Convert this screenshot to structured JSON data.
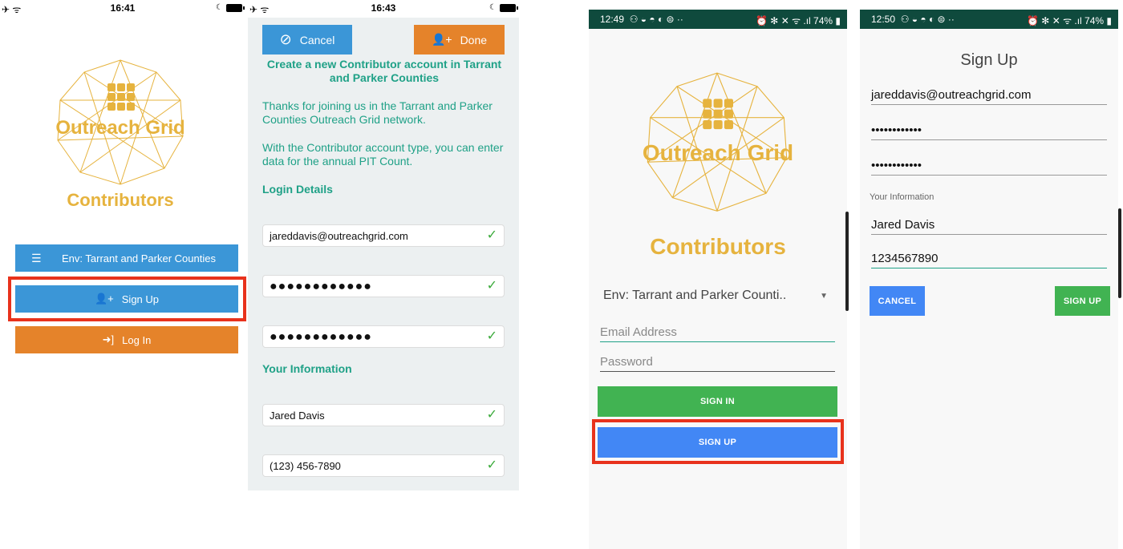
{
  "screen1": {
    "status": {
      "time": "16:41",
      "left": "✈ ᯤ"
    },
    "logo": {
      "title": "Outreach Grid",
      "subtitle": "Contributors"
    },
    "env_button": "Env: Tarrant and Parker Counties",
    "signup_button": "Sign Up",
    "login_button": "Log In"
  },
  "screen2": {
    "status": {
      "time": "16:43",
      "left": "✈ ᯤ"
    },
    "cancel_button": "Cancel",
    "done_button": "Done",
    "heading": "Create a new Contributor account in Tarrant and Parker Counties",
    "intro1": "Thanks for joining us in the Tarrant and Parker Counties Outreach Grid network.",
    "intro2": "With the Contributor account type, you can enter data for the annual PIT Count.",
    "login_section": "Login Details",
    "email": "jareddavis@outreachgrid.com",
    "password": "●●●●●●●●●●●●",
    "confirm_password": "●●●●●●●●●●●●",
    "info_section": "Your Information",
    "name": "Jared Davis",
    "phone": "(123) 456-7890"
  },
  "screen3": {
    "status": {
      "time": "12:49",
      "icons": "⚇ ◒ ◓ ◐ ⊜ ··",
      "right": "⏰ ✻ ✕ ᯤ .ıl 74% ▮"
    },
    "logo": {
      "title": "Outreach Grid",
      "subtitle": "Contributors"
    },
    "env_select": "Env: Tarrant and Parker Counti..",
    "email_placeholder": "Email Address",
    "password_placeholder": "Password",
    "signin_button": "SIGN IN",
    "signup_button": "SIGN UP"
  },
  "screen4": {
    "status": {
      "time": "12:50",
      "icons": "⚇ ◒ ◓ ◐ ⊜ ··",
      "right": "⏰ ✻ ✕ ᯤ .ıl 74% ▮"
    },
    "title": "Sign Up",
    "email": "jareddavis@outreachgrid.com",
    "password": "••••••••••••",
    "confirm_password": "••••••••••••",
    "info_label": "Your Information",
    "name": "Jared Davis",
    "phone": "1234567890",
    "cancel_button": "CANCEL",
    "signup_button": "SIGN UP"
  },
  "colors": {
    "ios_blue": "#3b96d7",
    "ios_orange": "#e5832a",
    "accent_green": "#1fa187",
    "android_green": "#41b352",
    "android_blue": "#4287f5",
    "highlight_red": "#e8321c",
    "logo_gold": "#e6b33e"
  }
}
